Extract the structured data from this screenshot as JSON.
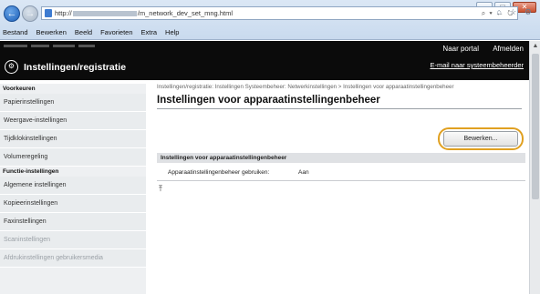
{
  "browser": {
    "address_prefix": "http://",
    "address_path": "/m_network_dev_set_mng.html",
    "address_controls": "⌕ ▾ ← ↻",
    "window_min": "–",
    "window_max": "□",
    "window_close": "✕",
    "home_icons": "⌂ ☆ ⚙",
    "menu": [
      "Bestand",
      "Bewerken",
      "Beeld",
      "Favorieten",
      "Extra",
      "Help"
    ]
  },
  "header": {
    "title": "Instellingen/registratie",
    "logo_glyph": "⚙",
    "portal_link": "Naar portal",
    "logout_link": "Afmelden",
    "mail_link": "E-mail naar systeembeheerder"
  },
  "sidebar": {
    "group1": "Voorkeuren",
    "group1_items": [
      "Papierinstellingen",
      "Weergave-instellingen",
      "Tijdklokinstellingen",
      "Volumeregeling"
    ],
    "group2": "Functie-instellingen",
    "group2_items": [
      "Algemene instellingen",
      "Kopieerinstellingen",
      "Faxinstellingen",
      "Scaninstellingen",
      "Afdrukinstellingen gebruikersmedia"
    ]
  },
  "main": {
    "breadcrumb": "Instellingen/registratie: Instellingen Systeembeheer: Netwerkinstellingen > Instellingen voor apparaatinstellingenbeheer",
    "title": "Instellingen voor apparaatinstellingenbeheer",
    "edit_button": "Bewerken...",
    "section_title": "Instellingen voor apparaatinstellingenbeheer",
    "setting_label": "Apparaatinstellingenbeheer gebruiken:",
    "setting_value": "Aan",
    "top_icon": "⤒"
  },
  "colors": {
    "header_bg": "#0b0b0b",
    "highlight": "#e0a020",
    "sidebar_bg": "#eef0f2"
  }
}
